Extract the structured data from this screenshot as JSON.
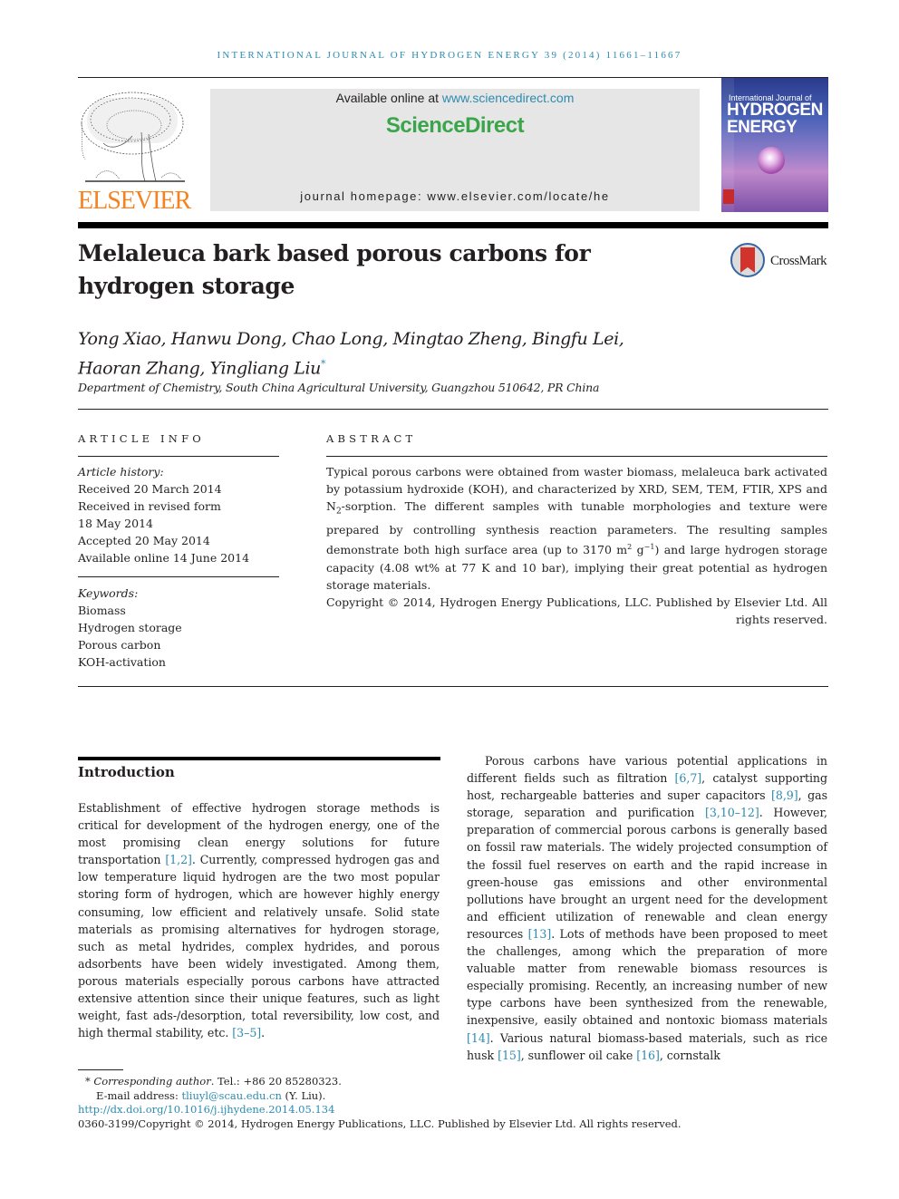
{
  "running_head": "INTERNATIONAL JOURNAL OF HYDROGEN ENERGY 39 (2014) 11661–11667",
  "publisher": {
    "logo_text": "ELSEVIER",
    "available_prefix": "Available online at ",
    "available_link": "www.sciencedirect.com",
    "sciencedirect": "ScienceDirect",
    "homepage": "journal homepage: www.elsevier.com/locate/he"
  },
  "cover": {
    "line1": "International Journal of",
    "line2": "HYDROGEN",
    "line3": "ENERGY"
  },
  "article": {
    "title": "Melaleuca bark based porous carbons for hydrogen storage",
    "crossmark": "CrossMark",
    "authors_line1": "Yong Xiao, Hanwu Dong, Chao Long, Mingtao Zheng, Bingfu Lei,",
    "authors_line2": "Haoran Zhang, Yingliang Liu",
    "corresponding_mark": "*",
    "affiliation": "Department of Chemistry, South China Agricultural University, Guangzhou 510642, PR China"
  },
  "article_info": {
    "heading": "ARTICLE INFO",
    "history_label": "Article history:",
    "history": [
      "Received 20 March 2014",
      "Received in revised form",
      "18 May 2014",
      "Accepted 20 May 2014",
      "Available online 14 June 2014"
    ],
    "keywords_label": "Keywords:",
    "keywords": [
      "Biomass",
      "Hydrogen storage",
      "Porous carbon",
      "KOH-activation"
    ]
  },
  "abstract": {
    "heading": "ABSTRACT",
    "p1": "Typical porous carbons were obtained from waster biomass, melaleuca bark activated by potassium hydroxide (KOH), and characterized by XRD, SEM, TEM, FTIR, XPS and N",
    "p1_sub": "2",
    "p2": "-sorption. The different samples with tunable morphologies and texture were prepared by controlling synthesis reaction parameters. The resulting samples demonstrate both high surface area (up to 3170 m",
    "p2_sup1": "2",
    "p3": " g",
    "p3_sup": "−1",
    "p4": ") and large hydrogen storage capacity (4.08 wt% at 77 K and 10 bar), implying their great potential as hydrogen storage materials.",
    "copyright": "Copyright © 2014, Hydrogen Energy Publications, LLC. Published by Elsevier Ltd. All rights reserved."
  },
  "introduction": {
    "heading": "Introduction",
    "left": [
      {
        "t": "Establishment of effective hydrogen storage methods is critical for development of the hydrogen energy, one of the most promising clean energy solutions for future transportation "
      },
      {
        "r": "[1,2]"
      },
      {
        "t": ". Currently, compressed hydrogen gas and low temperature liquid hydrogen are the two most popular storing form of hydrogen, which are however highly energy consuming, low efficient and relatively unsafe. Solid state materials as promising alternatives for hydrogen storage, such as metal hydrides, complex hydrides, and porous adsorbents have been widely investigated. Among them, porous materials especially porous carbons have attracted extensive attention since their unique features, such as light weight, fast ads-/desorption, total reversibility, low cost, and high thermal stability, etc. "
      },
      {
        "r": "[3–5]"
      },
      {
        "t": "."
      }
    ],
    "right": [
      {
        "t": "Porous carbons have various potential applications in different fields such as filtration "
      },
      {
        "r": "[6,7]"
      },
      {
        "t": ", catalyst supporting host, rechargeable batteries and super capacitors "
      },
      {
        "r": "[8,9]"
      },
      {
        "t": ", gas storage, separation and purification "
      },
      {
        "r": "[3,10–12]"
      },
      {
        "t": ". However, preparation of commercial porous carbons is generally based on fossil raw materials. The widely projected consumption of the fossil fuel reserves on earth and the rapid increase in green-house gas emissions and other environmental pollutions have brought an urgent need for the development and efficient utilization of renewable and clean energy resources "
      },
      {
        "r": "[13]"
      },
      {
        "t": ". Lots of methods have been proposed to meet the challenges, among which the preparation of more valuable matter from renewable biomass resources is especially promising. Recently, an increasing number of new type carbons have been synthesized from the renewable, inexpensive, easily obtained and nontoxic biomass materials "
      },
      {
        "r": "[14]"
      },
      {
        "t": ". Various natural biomass-based materials, such as rice husk "
      },
      {
        "r": "[15]"
      },
      {
        "t": ", sunflower oil cake "
      },
      {
        "r": "[16]"
      },
      {
        "t": ", cornstalk"
      }
    ]
  },
  "footnotes": {
    "corr_mark": "*",
    "corr_label": "Corresponding author",
    "tel": ". Tel.: +86 20 85280323.",
    "email_label": "E-mail address: ",
    "email": "tliuyl@scau.edu.cn",
    "email_suffix": " (Y. Liu).",
    "doi": "http://dx.doi.org/10.1016/j.ijhydene.2014.05.134",
    "issn_copyright": "0360-3199/Copyright © 2014, Hydrogen Energy Publications, LLC. Published by Elsevier Ltd. All rights reserved."
  },
  "colors": {
    "link": "#2d8bb0",
    "elsevier_orange": "#f58220",
    "sciencedirect_green": "#3aa54a"
  }
}
